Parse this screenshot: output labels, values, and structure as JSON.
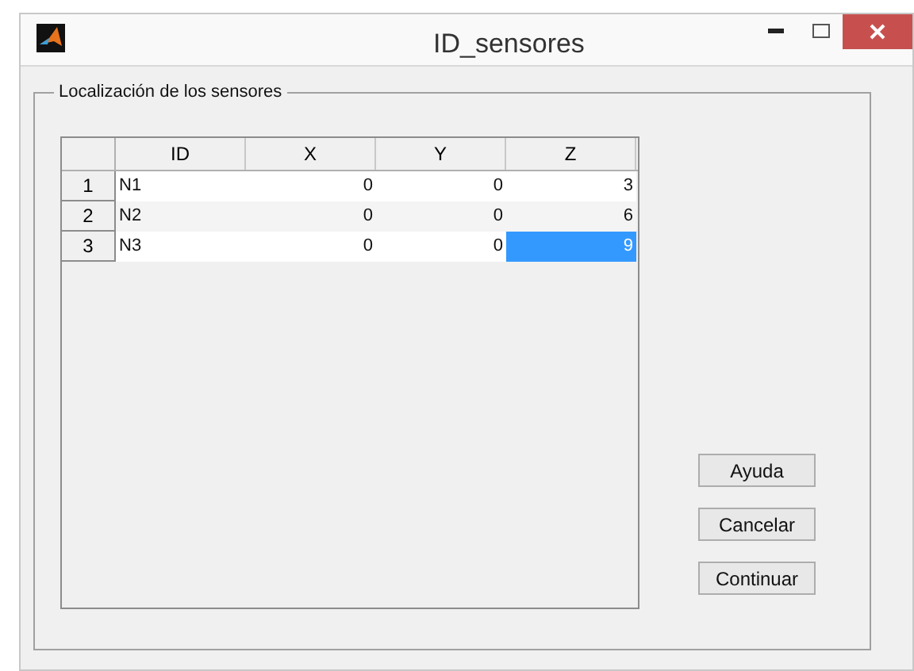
{
  "window": {
    "title": "ID_sensores"
  },
  "panel": {
    "title": "Localización de los sensores"
  },
  "table": {
    "columns": [
      "ID",
      "X",
      "Y",
      "Z"
    ],
    "rows": [
      {
        "header": "1",
        "cells": [
          {
            "text": "N1",
            "selected": false
          },
          {
            "text": "0",
            "selected": false
          },
          {
            "text": "0",
            "selected": false
          },
          {
            "text": "3",
            "selected": false
          }
        ]
      },
      {
        "header": "2",
        "cells": [
          {
            "text": "N2",
            "selected": false
          },
          {
            "text": "0",
            "selected": false
          },
          {
            "text": "0",
            "selected": false
          },
          {
            "text": "6",
            "selected": false
          }
        ]
      },
      {
        "header": "3",
        "cells": [
          {
            "text": "N3",
            "selected": false
          },
          {
            "text": "0",
            "selected": false
          },
          {
            "text": "0",
            "selected": false
          },
          {
            "text": "9",
            "selected": true
          }
        ]
      }
    ]
  },
  "buttons": [
    "Ayuda",
    "Cancelar",
    "Continuar"
  ]
}
